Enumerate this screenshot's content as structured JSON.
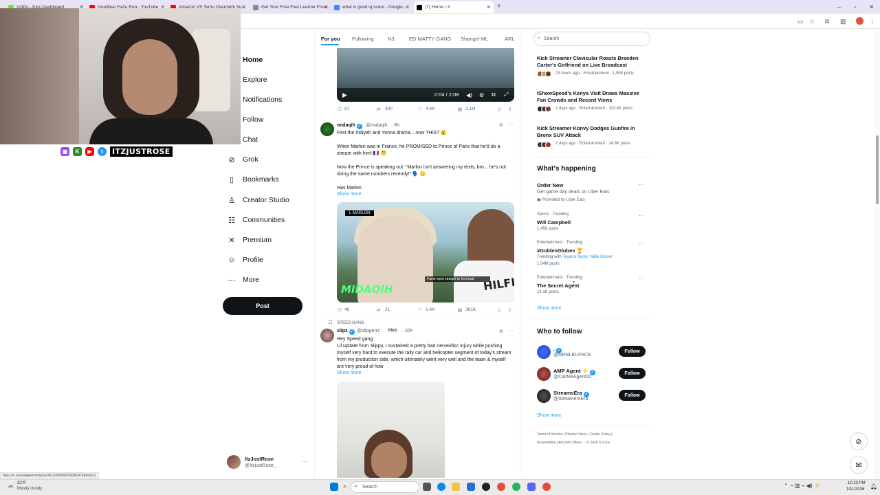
{
  "browser": {
    "tabs": [
      {
        "title": "VODs - Kick Dashboard",
        "color": "#53fc18",
        "active": false
      },
      {
        "title": "Goodbye FaZe Rug - YouTube",
        "color": "#ff0000",
        "active": false
      },
      {
        "title": "Amazon VS Temu Overnight Su...",
        "color": "#ff0000",
        "active": false
      },
      {
        "title": "Get Your Free Fast Learner Free...",
        "color": "#888888",
        "active": false
      },
      {
        "title": "what is good iq score - Google...",
        "color": "#4285f4",
        "active": false
      },
      {
        "title": "(7) Home / X",
        "color": "#000000",
        "active": true
      }
    ],
    "new_tab": "+",
    "status_url": "https://x.com/slipperrz/status/2010399866250361476/photo/1"
  },
  "overlay": {
    "handle": "ITZJUSTROSE"
  },
  "nav": {
    "items": [
      {
        "label": "Home",
        "icon": "home-icon",
        "glyph": "",
        "bold": true
      },
      {
        "label": "Explore",
        "icon": "explore-icon",
        "glyph": ""
      },
      {
        "label": "Notifications",
        "icon": "bell-icon",
        "glyph": ""
      },
      {
        "label": "Follow",
        "icon": "follow-icon",
        "glyph": ""
      },
      {
        "label": "Chat",
        "icon": "chat-icon",
        "glyph": ""
      },
      {
        "label": "Grok",
        "icon": "grok-icon",
        "glyph": "⊘"
      },
      {
        "label": "Bookmarks",
        "icon": "bookmark-icon",
        "glyph": "▯"
      },
      {
        "label": "Creator Studio",
        "icon": "creator-studio-icon",
        "glyph": "♙"
      },
      {
        "label": "Communities",
        "icon": "communities-icon",
        "glyph": "☷"
      },
      {
        "label": "Premium",
        "icon": "x-logo-icon",
        "glyph": "✕"
      },
      {
        "label": "Profile",
        "icon": "profile-icon",
        "glyph": "☺"
      },
      {
        "label": "More",
        "icon": "more-icon",
        "glyph": "⋯"
      }
    ],
    "post_button": "Post",
    "account": {
      "name": "ItzJustRose",
      "handle": "@ItzjustRose_",
      "more": "···"
    }
  },
  "feed": {
    "tabs": [
      "For you",
      "Following",
      "N3.",
      "ED MATTY GANG",
      "Shangel ML",
      "ARL"
    ],
    "video": {
      "time": "0:04 / 2:08"
    },
    "top_actions": {
      "replies": "87",
      "reposts": "400",
      "likes": "4.4K",
      "views": "3.1M"
    },
    "tweet1": {
      "name": "midaqih",
      "handle": "@midaqih",
      "time": "· 8h",
      "lines": [
        "First the Indiyah and Yonna drama... now THIS? 😮",
        "When Marlon was in France, he PROMISED to Prince of Paris that he'd do a stream with him! 🇫🇷 🤔",
        "Now the Prince is speaking out: \"Marlon isn't answering my texts, bro... he's not doing the same numbers recently!\" 🗣️ 😳",
        "Has Marlon"
      ],
      "show_more": "Show more",
      "image_caption": "L MARLON",
      "watermark": "MIDAQIH",
      "shirt_text": "HILFI",
      "chat_text": "Fame went straight to his head",
      "actions": {
        "replies": "46",
        "reposts": "21",
        "likes": "1.4K",
        "views": "361K"
      }
    },
    "tweet2": {
      "community": "SPEED GANG",
      "name": "slipz",
      "handle": "@slipperrz",
      "badge": "Mod",
      "time": "· 10h",
      "lines": [
        "Hey Speed gang",
        "Lil update from Slippy, I sustained a pretty bad nerve/disc injury while pushing myself very hard to execute the rally car and helicopter segment of today's stream from my production side, which ultimately went very well and the team & myself are very proud of how"
      ],
      "show_more": "Show more"
    }
  },
  "sidebar": {
    "search_placeholder": "Search",
    "news": [
      {
        "title": "Kick Streamer Clavicular Roasts Braeden Carter's Girlfriend on Live Broadcast",
        "meta": "23 hours ago · Entertainment · 1,954 posts"
      },
      {
        "title": "IShowSpeed's Kenya Visit Draws Massive Fan Crowds and Record Views",
        "meta": "2 days ago · Entertainment · 113.4K posts"
      },
      {
        "title": "Kick Streamer Konvy Dodges Gunfire in Bronx SUV Attack",
        "meta": "2 days ago · Entertainment · 24.6K posts"
      }
    ],
    "happening_title": "What's happening",
    "trends": [
      {
        "category": "",
        "name": "Order Now",
        "sub": "Get game day deals on Uber Eats",
        "count": "Promoted by Uber Eats"
      },
      {
        "category": "Sports · Trending",
        "name": "Will Campbell",
        "sub": "",
        "count": "1,458 posts"
      },
      {
        "category": "Entertainment · Trending",
        "name": "#GoldenGlobes 🏆",
        "sub_prefix": "Trending with",
        "sub_links": "Teyana Taylor, Nikki Glaser",
        "count": "1.04M posts"
      },
      {
        "category": "Entertainment · Trending",
        "name": "The Secret Agent",
        "sub": "",
        "count": "14.1K posts"
      }
    ],
    "trends_more": "Show more",
    "wtf_title": "Who to follow",
    "follow_suggestions": [
      {
        "name": ".",
        "handle": "@MRBLEUFACE",
        "button": "Follow",
        "color": "#1d3fd6"
      },
      {
        "name": "AMP Agent ⚡",
        "handle": "@CallMeAgent00",
        "button": "Follow",
        "color": "#7a2b2b"
      },
      {
        "name": "StreamsEra",
        "handle": "@StreamersEra",
        "button": "Follow",
        "color": "#1a1a1a"
      }
    ],
    "wtf_more": "Show more",
    "footer_row1": [
      "Terms of Service",
      "|",
      "Privacy Policy",
      "|",
      "Cookie Policy",
      "|"
    ],
    "footer_row2": [
      "Accessibility",
      "|",
      "Ads info",
      "|",
      "More ···",
      "© 2026 X Corp."
    ]
  },
  "taskbar": {
    "temp": "32°F",
    "weather": "Mostly cloudy",
    "search": "Search",
    "time": "10:23 PM",
    "date": "1/11/2026"
  },
  "colors": {
    "accent": "#1d9bf0",
    "text": "#0f1419",
    "muted": "#536471"
  }
}
